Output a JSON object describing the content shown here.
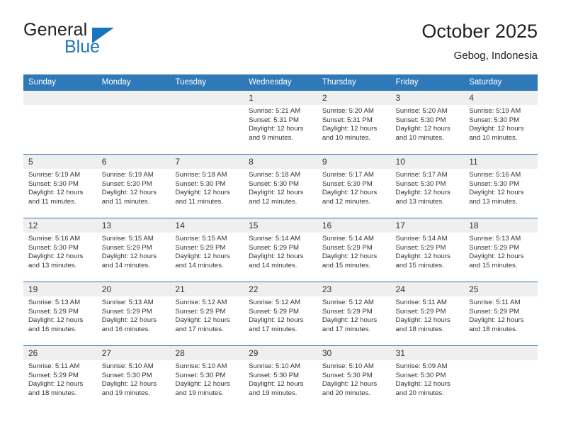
{
  "brand": {
    "word1": "General",
    "word2": "Blue",
    "triangle_color": "#1b75bc"
  },
  "header": {
    "title": "October 2025",
    "subtitle": "Gebog, Indonesia"
  },
  "theme": {
    "header_blue": "#3079b8",
    "grid_line": "#2e74b5",
    "daynum_band": "#efefef",
    "text": "#333333"
  },
  "weekdays": [
    "Sunday",
    "Monday",
    "Tuesday",
    "Wednesday",
    "Thursday",
    "Friday",
    "Saturday"
  ],
  "labels": {
    "sunrise": "Sunrise:",
    "sunset": "Sunset:",
    "daylight": "Daylight:"
  },
  "weeks": [
    [
      {
        "day": ""
      },
      {
        "day": ""
      },
      {
        "day": ""
      },
      {
        "day": "1",
        "sunrise": "Sunrise: 5:21 AM",
        "sunset": "Sunset: 5:31 PM",
        "daylight_1": "Daylight: 12 hours",
        "daylight_2": "and 9 minutes."
      },
      {
        "day": "2",
        "sunrise": "Sunrise: 5:20 AM",
        "sunset": "Sunset: 5:31 PM",
        "daylight_1": "Daylight: 12 hours",
        "daylight_2": "and 10 minutes."
      },
      {
        "day": "3",
        "sunrise": "Sunrise: 5:20 AM",
        "sunset": "Sunset: 5:30 PM",
        "daylight_1": "Daylight: 12 hours",
        "daylight_2": "and 10 minutes."
      },
      {
        "day": "4",
        "sunrise": "Sunrise: 5:19 AM",
        "sunset": "Sunset: 5:30 PM",
        "daylight_1": "Daylight: 12 hours",
        "daylight_2": "and 10 minutes."
      }
    ],
    [
      {
        "day": "5",
        "sunrise": "Sunrise: 5:19 AM",
        "sunset": "Sunset: 5:30 PM",
        "daylight_1": "Daylight: 12 hours",
        "daylight_2": "and 11 minutes."
      },
      {
        "day": "6",
        "sunrise": "Sunrise: 5:19 AM",
        "sunset": "Sunset: 5:30 PM",
        "daylight_1": "Daylight: 12 hours",
        "daylight_2": "and 11 minutes."
      },
      {
        "day": "7",
        "sunrise": "Sunrise: 5:18 AM",
        "sunset": "Sunset: 5:30 PM",
        "daylight_1": "Daylight: 12 hours",
        "daylight_2": "and 11 minutes."
      },
      {
        "day": "8",
        "sunrise": "Sunrise: 5:18 AM",
        "sunset": "Sunset: 5:30 PM",
        "daylight_1": "Daylight: 12 hours",
        "daylight_2": "and 12 minutes."
      },
      {
        "day": "9",
        "sunrise": "Sunrise: 5:17 AM",
        "sunset": "Sunset: 5:30 PM",
        "daylight_1": "Daylight: 12 hours",
        "daylight_2": "and 12 minutes."
      },
      {
        "day": "10",
        "sunrise": "Sunrise: 5:17 AM",
        "sunset": "Sunset: 5:30 PM",
        "daylight_1": "Daylight: 12 hours",
        "daylight_2": "and 13 minutes."
      },
      {
        "day": "11",
        "sunrise": "Sunrise: 5:16 AM",
        "sunset": "Sunset: 5:30 PM",
        "daylight_1": "Daylight: 12 hours",
        "daylight_2": "and 13 minutes."
      }
    ],
    [
      {
        "day": "12",
        "sunrise": "Sunrise: 5:16 AM",
        "sunset": "Sunset: 5:30 PM",
        "daylight_1": "Daylight: 12 hours",
        "daylight_2": "and 13 minutes."
      },
      {
        "day": "13",
        "sunrise": "Sunrise: 5:15 AM",
        "sunset": "Sunset: 5:29 PM",
        "daylight_1": "Daylight: 12 hours",
        "daylight_2": "and 14 minutes."
      },
      {
        "day": "14",
        "sunrise": "Sunrise: 5:15 AM",
        "sunset": "Sunset: 5:29 PM",
        "daylight_1": "Daylight: 12 hours",
        "daylight_2": "and 14 minutes."
      },
      {
        "day": "15",
        "sunrise": "Sunrise: 5:14 AM",
        "sunset": "Sunset: 5:29 PM",
        "daylight_1": "Daylight: 12 hours",
        "daylight_2": "and 14 minutes."
      },
      {
        "day": "16",
        "sunrise": "Sunrise: 5:14 AM",
        "sunset": "Sunset: 5:29 PM",
        "daylight_1": "Daylight: 12 hours",
        "daylight_2": "and 15 minutes."
      },
      {
        "day": "17",
        "sunrise": "Sunrise: 5:14 AM",
        "sunset": "Sunset: 5:29 PM",
        "daylight_1": "Daylight: 12 hours",
        "daylight_2": "and 15 minutes."
      },
      {
        "day": "18",
        "sunrise": "Sunrise: 5:13 AM",
        "sunset": "Sunset: 5:29 PM",
        "daylight_1": "Daylight: 12 hours",
        "daylight_2": "and 15 minutes."
      }
    ],
    [
      {
        "day": "19",
        "sunrise": "Sunrise: 5:13 AM",
        "sunset": "Sunset: 5:29 PM",
        "daylight_1": "Daylight: 12 hours",
        "daylight_2": "and 16 minutes."
      },
      {
        "day": "20",
        "sunrise": "Sunrise: 5:13 AM",
        "sunset": "Sunset: 5:29 PM",
        "daylight_1": "Daylight: 12 hours",
        "daylight_2": "and 16 minutes."
      },
      {
        "day": "21",
        "sunrise": "Sunrise: 5:12 AM",
        "sunset": "Sunset: 5:29 PM",
        "daylight_1": "Daylight: 12 hours",
        "daylight_2": "and 17 minutes."
      },
      {
        "day": "22",
        "sunrise": "Sunrise: 5:12 AM",
        "sunset": "Sunset: 5:29 PM",
        "daylight_1": "Daylight: 12 hours",
        "daylight_2": "and 17 minutes."
      },
      {
        "day": "23",
        "sunrise": "Sunrise: 5:12 AM",
        "sunset": "Sunset: 5:29 PM",
        "daylight_1": "Daylight: 12 hours",
        "daylight_2": "and 17 minutes."
      },
      {
        "day": "24",
        "sunrise": "Sunrise: 5:11 AM",
        "sunset": "Sunset: 5:29 PM",
        "daylight_1": "Daylight: 12 hours",
        "daylight_2": "and 18 minutes."
      },
      {
        "day": "25",
        "sunrise": "Sunrise: 5:11 AM",
        "sunset": "Sunset: 5:29 PM",
        "daylight_1": "Daylight: 12 hours",
        "daylight_2": "and 18 minutes."
      }
    ],
    [
      {
        "day": "26",
        "sunrise": "Sunrise: 5:11 AM",
        "sunset": "Sunset: 5:29 PM",
        "daylight_1": "Daylight: 12 hours",
        "daylight_2": "and 18 minutes."
      },
      {
        "day": "27",
        "sunrise": "Sunrise: 5:10 AM",
        "sunset": "Sunset: 5:30 PM",
        "daylight_1": "Daylight: 12 hours",
        "daylight_2": "and 19 minutes."
      },
      {
        "day": "28",
        "sunrise": "Sunrise: 5:10 AM",
        "sunset": "Sunset: 5:30 PM",
        "daylight_1": "Daylight: 12 hours",
        "daylight_2": "and 19 minutes."
      },
      {
        "day": "29",
        "sunrise": "Sunrise: 5:10 AM",
        "sunset": "Sunset: 5:30 PM",
        "daylight_1": "Daylight: 12 hours",
        "daylight_2": "and 19 minutes."
      },
      {
        "day": "30",
        "sunrise": "Sunrise: 5:10 AM",
        "sunset": "Sunset: 5:30 PM",
        "daylight_1": "Daylight: 12 hours",
        "daylight_2": "and 20 minutes."
      },
      {
        "day": "31",
        "sunrise": "Sunrise: 5:09 AM",
        "sunset": "Sunset: 5:30 PM",
        "daylight_1": "Daylight: 12 hours",
        "daylight_2": "and 20 minutes."
      },
      {
        "day": ""
      }
    ]
  ]
}
